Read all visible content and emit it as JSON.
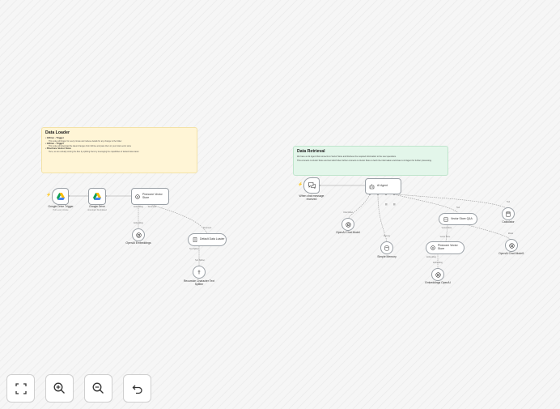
{
  "loader_note": {
    "title": "Data Loader",
    "items": [
      {
        "head": "GDrive - Trigger",
        "desc": "This node will trigger for every minute and retrieve details for any change to the folder"
      },
      {
        "head": "GDrive - Trigger",
        "desc": "This node will download the latest changes from GDrive and pass them to your local vector store"
      },
      {
        "head": "PineCone Vector Store",
        "desc": "Here, we are actually storing the files by splitting them by leveraging the capabilities of default data loader"
      }
    ]
  },
  "retrieval_note": {
    "title": "Data Retrieval",
    "paragraphs": [
      "We have an AI Agent that connects to Vector Store and Retrieve the required information to the user questions.",
      "This connects to Vector Store and tool which then further connects to Vector Store to fetch the information and share to AI Agent for further processing."
    ]
  },
  "nodes": {
    "drive_trigger": {
      "label": "Google Drive Trigger",
      "sub": "Poll: every minute"
    },
    "drive": {
      "label": "Google Drive",
      "sub": "download: fileUpdated"
    },
    "pinecone_store": {
      "label": "Pinecone Vector Store"
    },
    "openai_embeddings": {
      "label": "OpenAI Embeddings"
    },
    "data_loader": {
      "label": "Default Data Loader"
    },
    "text_splitter": {
      "label": "Recursive Character Text Splitter"
    },
    "chat_trigger": {
      "label": "When chat message received"
    },
    "ai_agent": {
      "label": "AI Agent"
    },
    "chat_model": {
      "label": "OpenAI Chat Model"
    },
    "memory": {
      "label": "Simple Memory"
    },
    "vector_qa": {
      "label": "Vector Store Q&A"
    },
    "calculator": {
      "label": "Calculator"
    },
    "pinecone_store2": {
      "label": "Pinecone Vector Store"
    },
    "chat_model2": {
      "label": "OpenAI Chat Model1"
    },
    "embeddings2": {
      "label": "Embeddings OpenAI"
    }
  },
  "ports": {
    "embedding": "Embedding",
    "document": "Document",
    "text_splitter": "Text Splitter",
    "chat_model": "Chat Model",
    "memory": "Memory",
    "tool": "Tool",
    "vector_store": "Vector Store",
    "model": "Model",
    "embeddings": "Embedding"
  },
  "controls": {
    "fit": "fit-view",
    "zoom_in": "zoom-in",
    "zoom_out": "zoom-out",
    "undo": "undo"
  }
}
